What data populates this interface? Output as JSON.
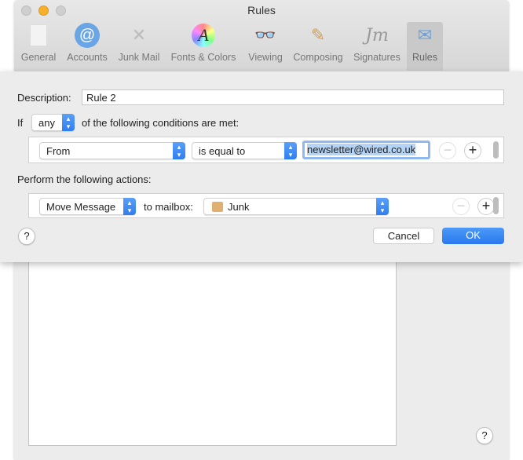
{
  "window": {
    "title": "Rules"
  },
  "toolbar": {
    "items": [
      {
        "label": "General",
        "icon": "general-switch-icon"
      },
      {
        "label": "Accounts",
        "icon": "at-sign-icon"
      },
      {
        "label": "Junk Mail",
        "icon": "junk-bin-icon"
      },
      {
        "label": "Fonts & Colors",
        "icon": "font-color-wheel-icon"
      },
      {
        "label": "Viewing",
        "icon": "glasses-icon"
      },
      {
        "label": "Composing",
        "icon": "pencil-paper-icon"
      },
      {
        "label": "Signatures",
        "icon": "signature-icon"
      },
      {
        "label": "Rules",
        "icon": "rules-envelope-icon",
        "selected": true
      }
    ]
  },
  "sheet": {
    "description_label": "Description:",
    "description_value": "Rule 2",
    "if_label": "If",
    "match_value": "any",
    "conditions_label": "of the following conditions are met:",
    "condition": {
      "field": "From",
      "operator": "is equal to",
      "value": "newsletter@wired.co.uk"
    },
    "actions_label": "Perform the following actions:",
    "action": {
      "type": "Move Message",
      "to_label": "to mailbox:",
      "mailbox": "Junk"
    },
    "cancel": "Cancel",
    "ok": "OK",
    "help": "?"
  },
  "main": {
    "help": "?"
  },
  "colors": {
    "accent": "#2f7ef0",
    "selection": "#b3d3f7"
  }
}
